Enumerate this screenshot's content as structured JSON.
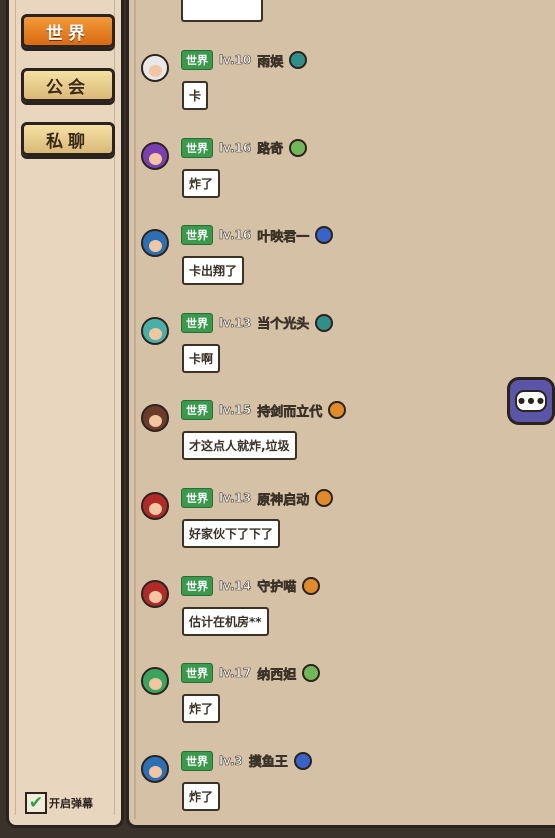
{
  "sidebar": {
    "tabs": [
      {
        "label": "世界",
        "active": true
      },
      {
        "label": "公会",
        "active": false
      },
      {
        "label": "私聊",
        "active": false
      }
    ],
    "toggle": {
      "label": "开启弹幕",
      "checked": true
    }
  },
  "messages": [
    {
      "channel": "世界",
      "level": "lv.10",
      "name": "雨娱",
      "class_icon": "teal-compass-icon",
      "text": "卡",
      "avatar_hair": "#e8e8e8"
    },
    {
      "channel": "世界",
      "level": "lv.16",
      "name": "路奇",
      "class_icon": "green-leaf-icon",
      "text": "炸了",
      "avatar_hair": "#7a3fb0"
    },
    {
      "channel": "世界",
      "level": "lv.16",
      "name": "叶映君一",
      "class_icon": "blue-staff-icon",
      "text": "卡出翔了",
      "avatar_hair": "#2d6fb5"
    },
    {
      "channel": "世界",
      "level": "lv.13",
      "name": "当个光头",
      "class_icon": "teal-compass-icon",
      "text": "卡啊",
      "avatar_hair": "#49b0a8"
    },
    {
      "channel": "世界",
      "level": "lv.15",
      "name": "持剑而立代",
      "class_icon": "orange-sword-icon",
      "text": "才这点人就炸,垃圾",
      "avatar_hair": "#6b3a2a"
    },
    {
      "channel": "世界",
      "level": "lv.13",
      "name": "原神启动",
      "class_icon": "orange-sword-icon",
      "text": "好家伙下了下了",
      "avatar_hair": "#b02a2a"
    },
    {
      "channel": "世界",
      "level": "lv.14",
      "name": "守护喵",
      "class_icon": "orange-sword-icon",
      "text": "估计在机房**",
      "avatar_hair": "#b02a2a"
    },
    {
      "channel": "世界",
      "level": "lv.17",
      "name": "纳西妲",
      "class_icon": "green-leaf-icon",
      "text": "炸了",
      "avatar_hair": "#3aa35c"
    },
    {
      "channel": "世界",
      "level": "lv.3",
      "name": "摸鱼王",
      "class_icon": "blue-staff-icon",
      "text": "炸了",
      "avatar_hair": "#2d6fb5"
    }
  ],
  "colors": {
    "teal-compass-icon": "#2f8f8a",
    "green-leaf-icon": "#6fb85a",
    "blue-staff-icon": "#3a63c9",
    "orange-sword-icon": "#e08a2a"
  },
  "chat_button": {
    "icon": "chat-bubble-icon"
  }
}
